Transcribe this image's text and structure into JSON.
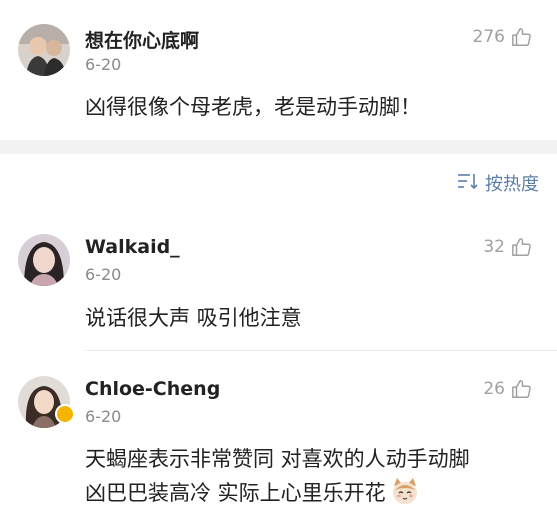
{
  "comments": [
    {
      "username": "想在你心底啊",
      "date": "6-20",
      "likes": "276",
      "text_lines": [
        "凶得很像个母老虎，老是动手动脚！"
      ]
    },
    {
      "username": "Walkaid_",
      "date": "6-20",
      "likes": "32",
      "text_lines": [
        "说话很大声 吸引他注意"
      ]
    },
    {
      "username": "Chloe-Cheng",
      "date": "6-20",
      "likes": "26",
      "text_lines": [
        "天蝎座表示非常赞同 对喜欢的人动手动脚",
        "凶巴巴装高冷 实际上心里乐开花"
      ],
      "verified_badge_color": "#f5b400"
    }
  ],
  "sort": {
    "label": "按热度",
    "icon": "sort-icon"
  },
  "colors": {
    "sort_accent": "#5b7fa8",
    "meta_gray": "#8a8a8a",
    "like_gray": "#a0a0a0",
    "band_gray": "#f2f2f2"
  },
  "icons": {
    "like": "thumbs-up-icon",
    "emoji": "cat-emoji-icon",
    "verified": "verified-badge-icon"
  }
}
